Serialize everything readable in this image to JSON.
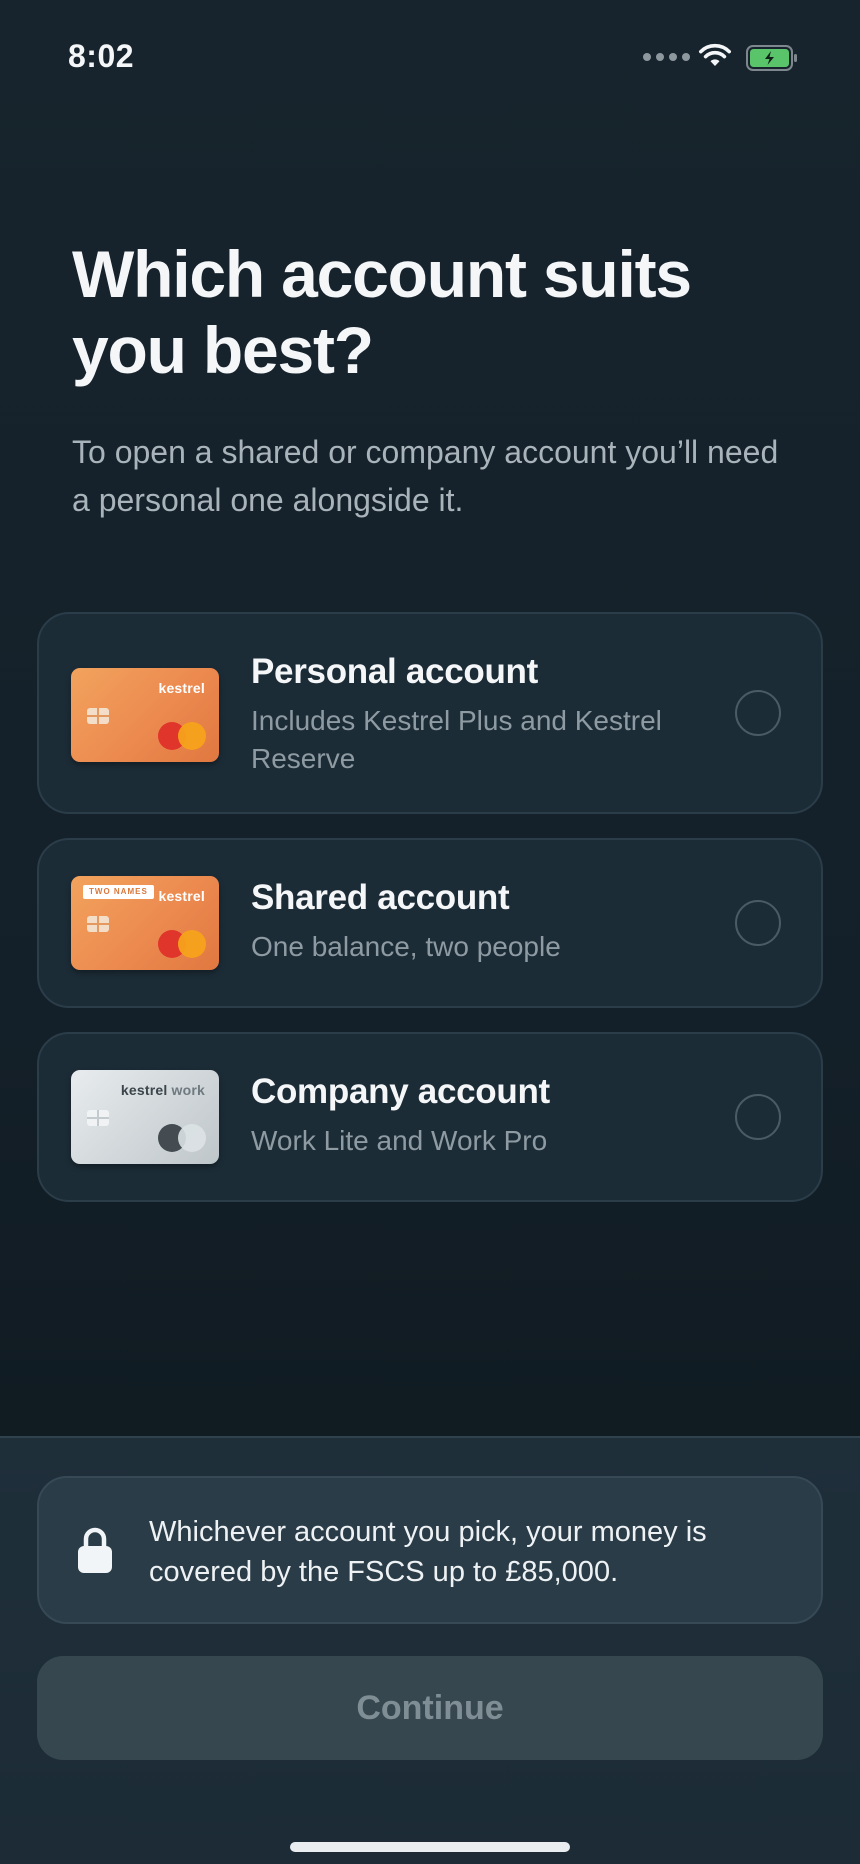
{
  "status_bar": {
    "time": "8:02",
    "icons": [
      "signal-dots-icon",
      "wifi-icon",
      "battery-charging-icon"
    ],
    "battery_color": "#5ac46b"
  },
  "header": {
    "title": "Which account suits you best?",
    "subtitle": "To open a shared or company account you’ll need a personal one alongside it."
  },
  "options": [
    {
      "title": "Personal account",
      "description": "Includes Kestrel Plus and Kestrel Reserve",
      "card_brand": "kestrel",
      "card_style": "orange",
      "selected": false
    },
    {
      "title": "Shared account",
      "description": "One balance, two people",
      "card_brand": "kestrel",
      "card_tag": "TWO NAMES",
      "card_style": "orange",
      "selected": false
    },
    {
      "title": "Company account",
      "description": "Work Lite and Work Pro",
      "card_brand": "kestrel",
      "card_brand_suffix": "work",
      "card_style": "silver",
      "selected": false
    }
  ],
  "footer": {
    "notice_icon": "lock-icon",
    "notice_text": "Whichever account you pick, your money is covered by the FSCS up to £85,000.",
    "continue_label": "Continue",
    "continue_enabled": false
  },
  "colors": {
    "background": "#15222b",
    "card_background": "#1c2c37",
    "card_orange": "#ec8a50",
    "button_disabled": "#36474f"
  }
}
